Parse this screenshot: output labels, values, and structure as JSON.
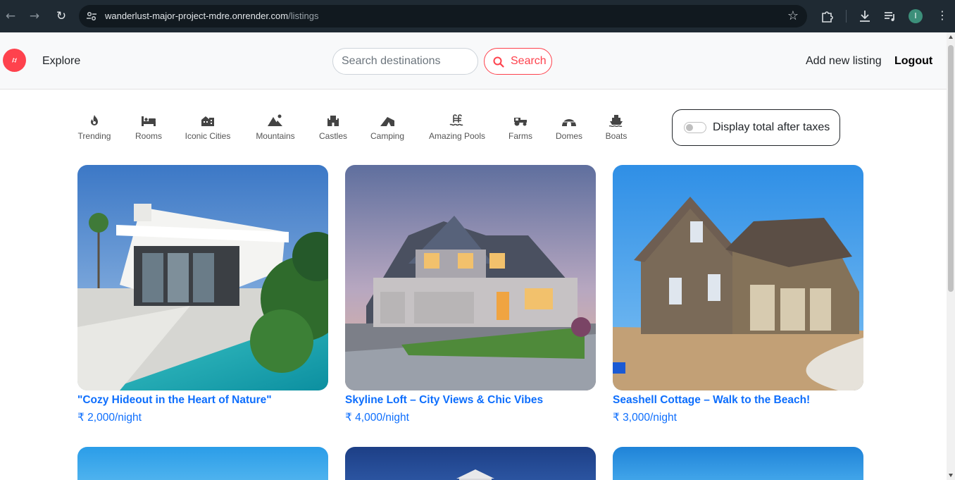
{
  "browser": {
    "url_host": "wanderlust-major-project-mdre.onrender.com",
    "url_path": "/listings",
    "profile_initial": "I"
  },
  "nav": {
    "explore": "Explore",
    "search_placeholder": "Search destinations",
    "search_button": "Search",
    "add_listing": "Add new listing",
    "logout": "Logout",
    "brand_color": "#fe424d"
  },
  "filters": [
    {
      "label": "Trending",
      "icon": "fire-icon"
    },
    {
      "label": "Rooms",
      "icon": "bed-icon"
    },
    {
      "label": "Iconic Cities",
      "icon": "city-icon"
    },
    {
      "label": "Mountains",
      "icon": "mountain-icon"
    },
    {
      "label": "Castles",
      "icon": "castle-icon"
    },
    {
      "label": "Camping",
      "icon": "campground-icon"
    },
    {
      "label": "Amazing Pools",
      "icon": "pool-icon"
    },
    {
      "label": "Farms",
      "icon": "tractor-icon"
    },
    {
      "label": "Domes",
      "icon": "igloo-icon"
    },
    {
      "label": "Boats",
      "icon": "ship-icon"
    }
  ],
  "tax_toggle": {
    "label": "Display total after taxes",
    "checked": false
  },
  "listings": [
    {
      "title": "\"Cozy Hideout in the Heart of Nature\"",
      "price": "₹ 2,000/night"
    },
    {
      "title": "Skyline Loft – City Views & Chic Vibes",
      "price": "₹ 4,000/night"
    },
    {
      "title": "Seashell Cottage – Walk to the Beach!",
      "price": "₹ 3,000/night"
    }
  ]
}
